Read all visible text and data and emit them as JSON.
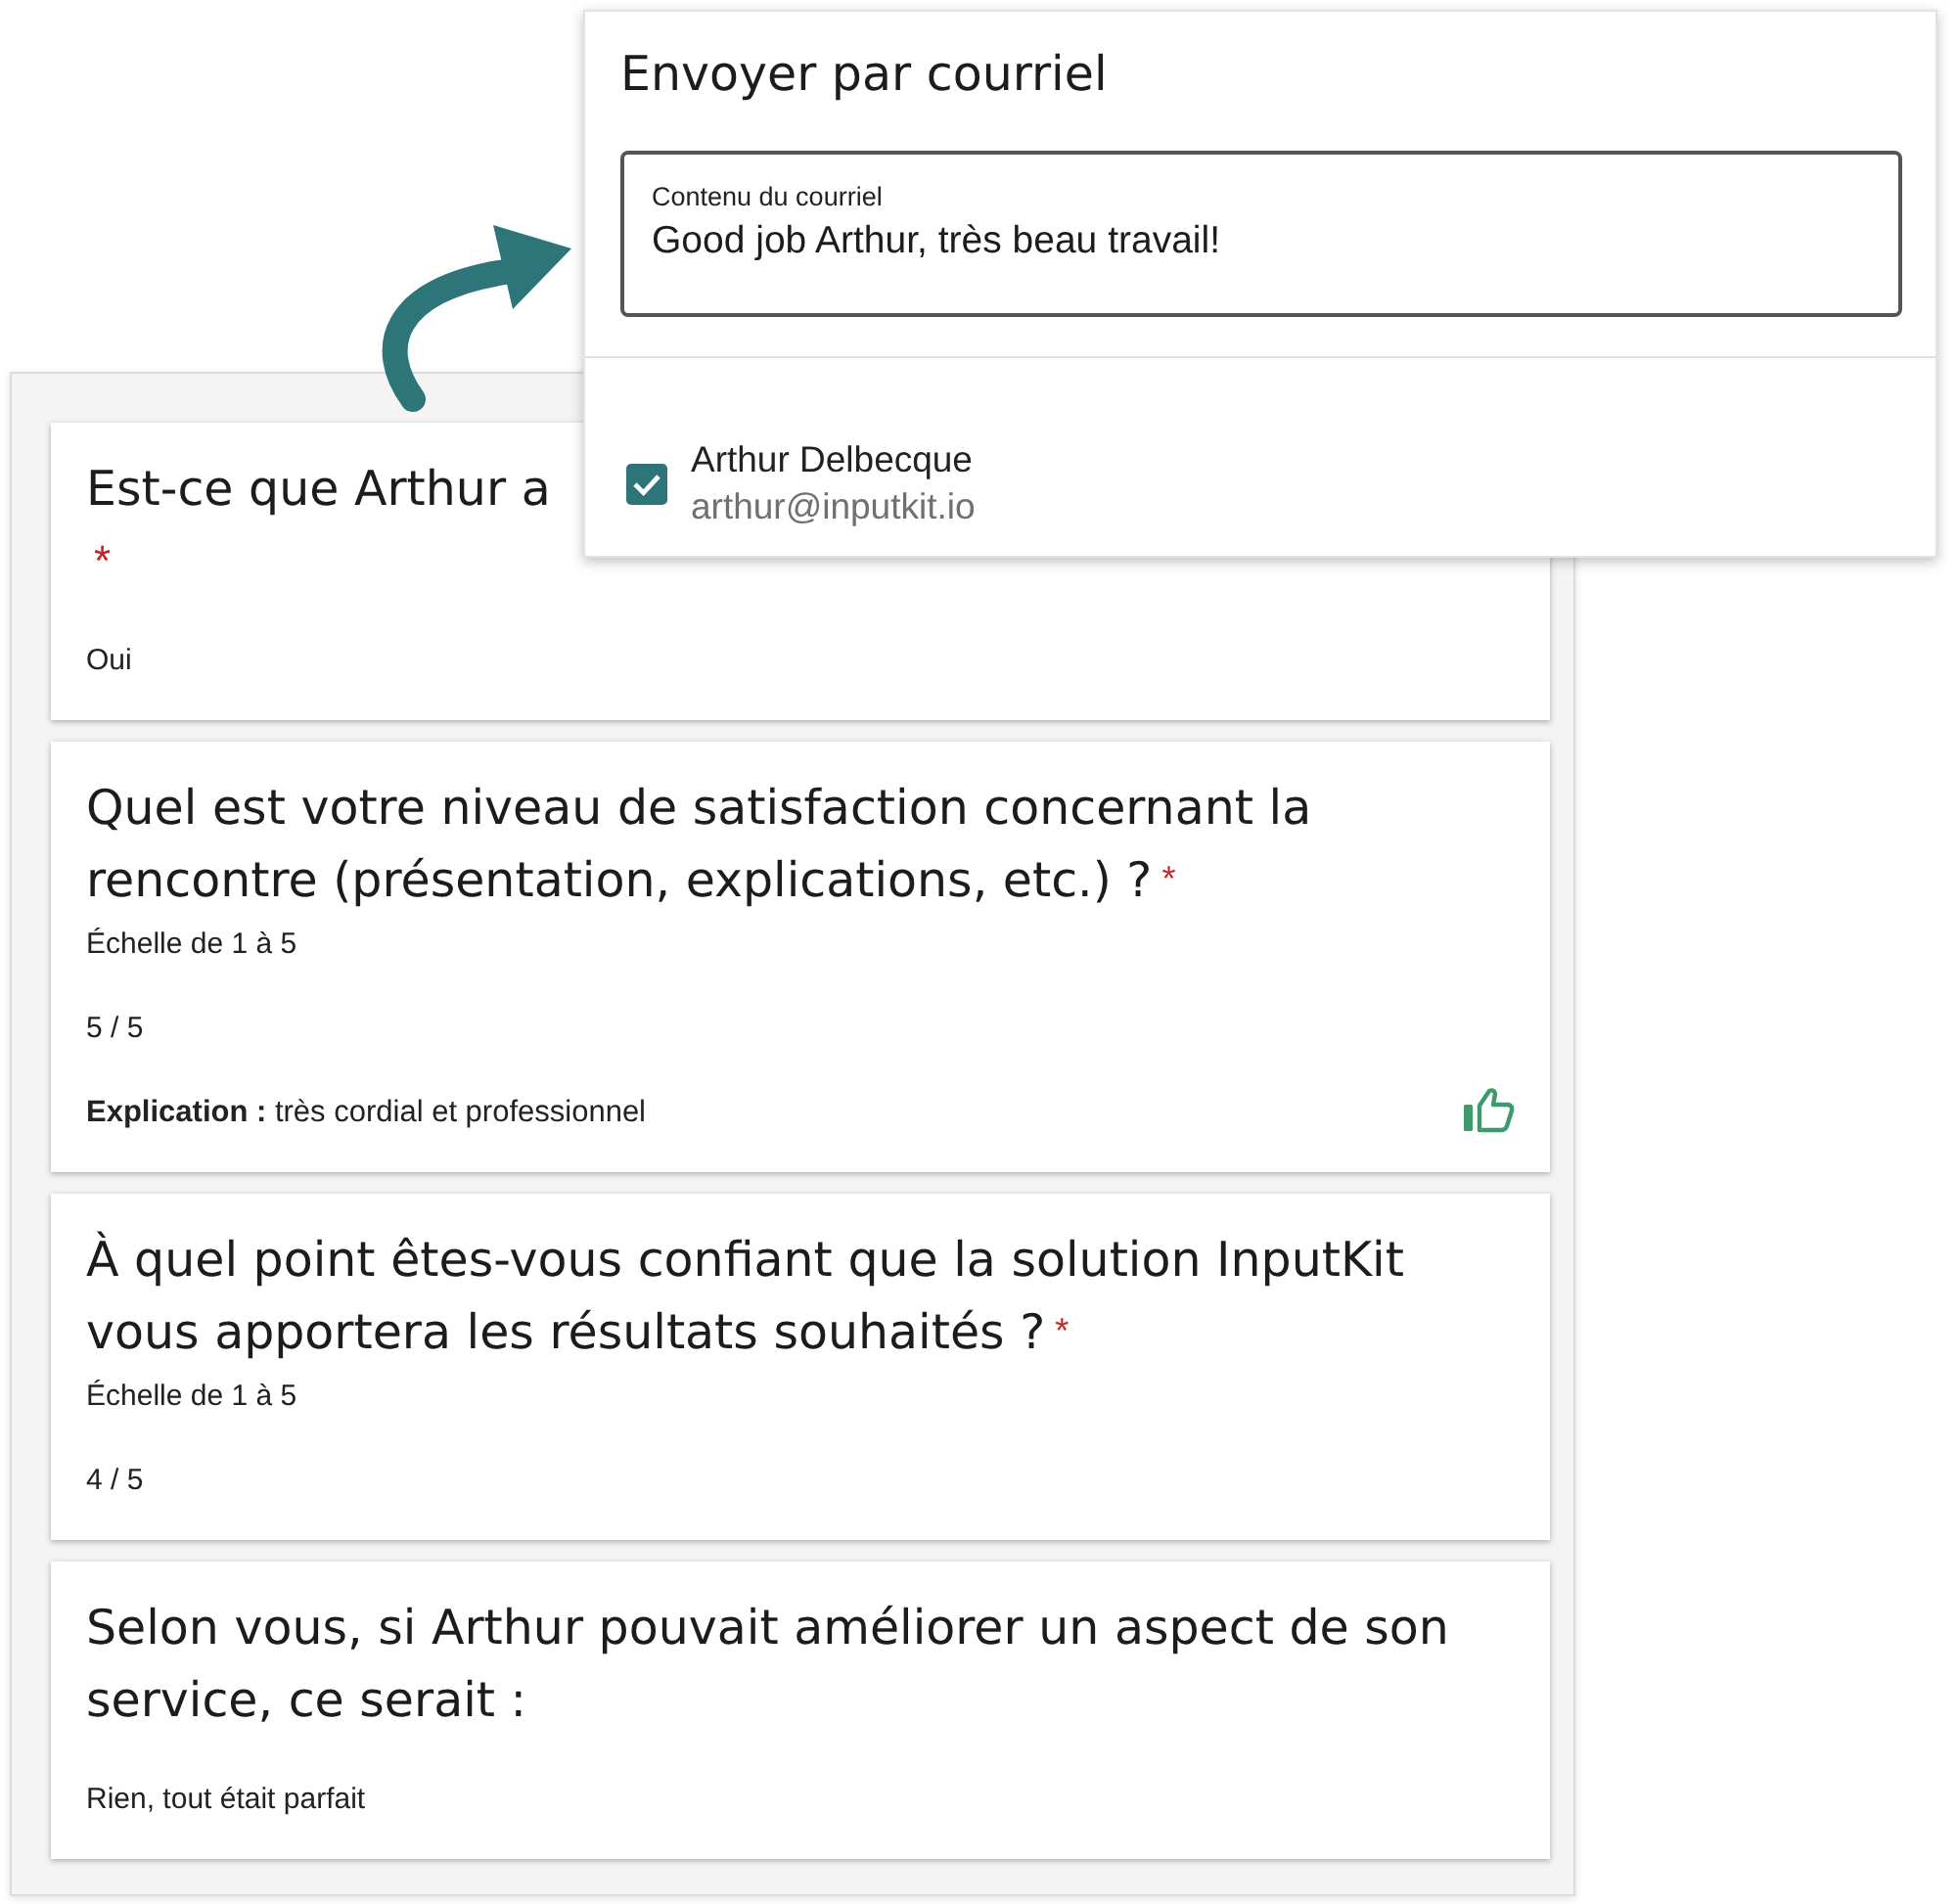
{
  "form": {
    "questions": [
      {
        "title": "Est-ce que Arthur a",
        "truncated": true,
        "required_mark": "*",
        "answer": "Oui"
      },
      {
        "title": "Quel est votre niveau de satisfaction concernant la rencontre (présentation, explications, etc.) ?",
        "truncated": false,
        "required_mark": "*",
        "hint": "Échelle de 1 à 5",
        "answer": "5 / 5",
        "explanation": "**Explication :** très cordial et professionnel",
        "thumbs_up": true
      },
      {
        "title": "À quel point êtes-vous confiant que la solution InputKit vous apportera les résultats souhaités ?",
        "truncated": false,
        "required_mark": "*",
        "hint": "Échelle de 1 à 5",
        "answer": "4 / 5",
        "thumbs_up": false
      },
      {
        "title": "Selon vous, si Arthur pouvait améliorer un aspect de son service, ce serait :",
        "truncated": false,
        "answer": "Rien, tout était parfait",
        "thumbs_up": false
      }
    ]
  },
  "dialog": {
    "title": "Envoyer par courriel",
    "message": {
      "label": "Contenu du courriel",
      "value": "Good job Arthur, très beau travail!"
    },
    "recipients": [
      {
        "name": "Arthur Delbecque",
        "email": "arthur@inputkit.io",
        "checked": true
      }
    ]
  }
}
